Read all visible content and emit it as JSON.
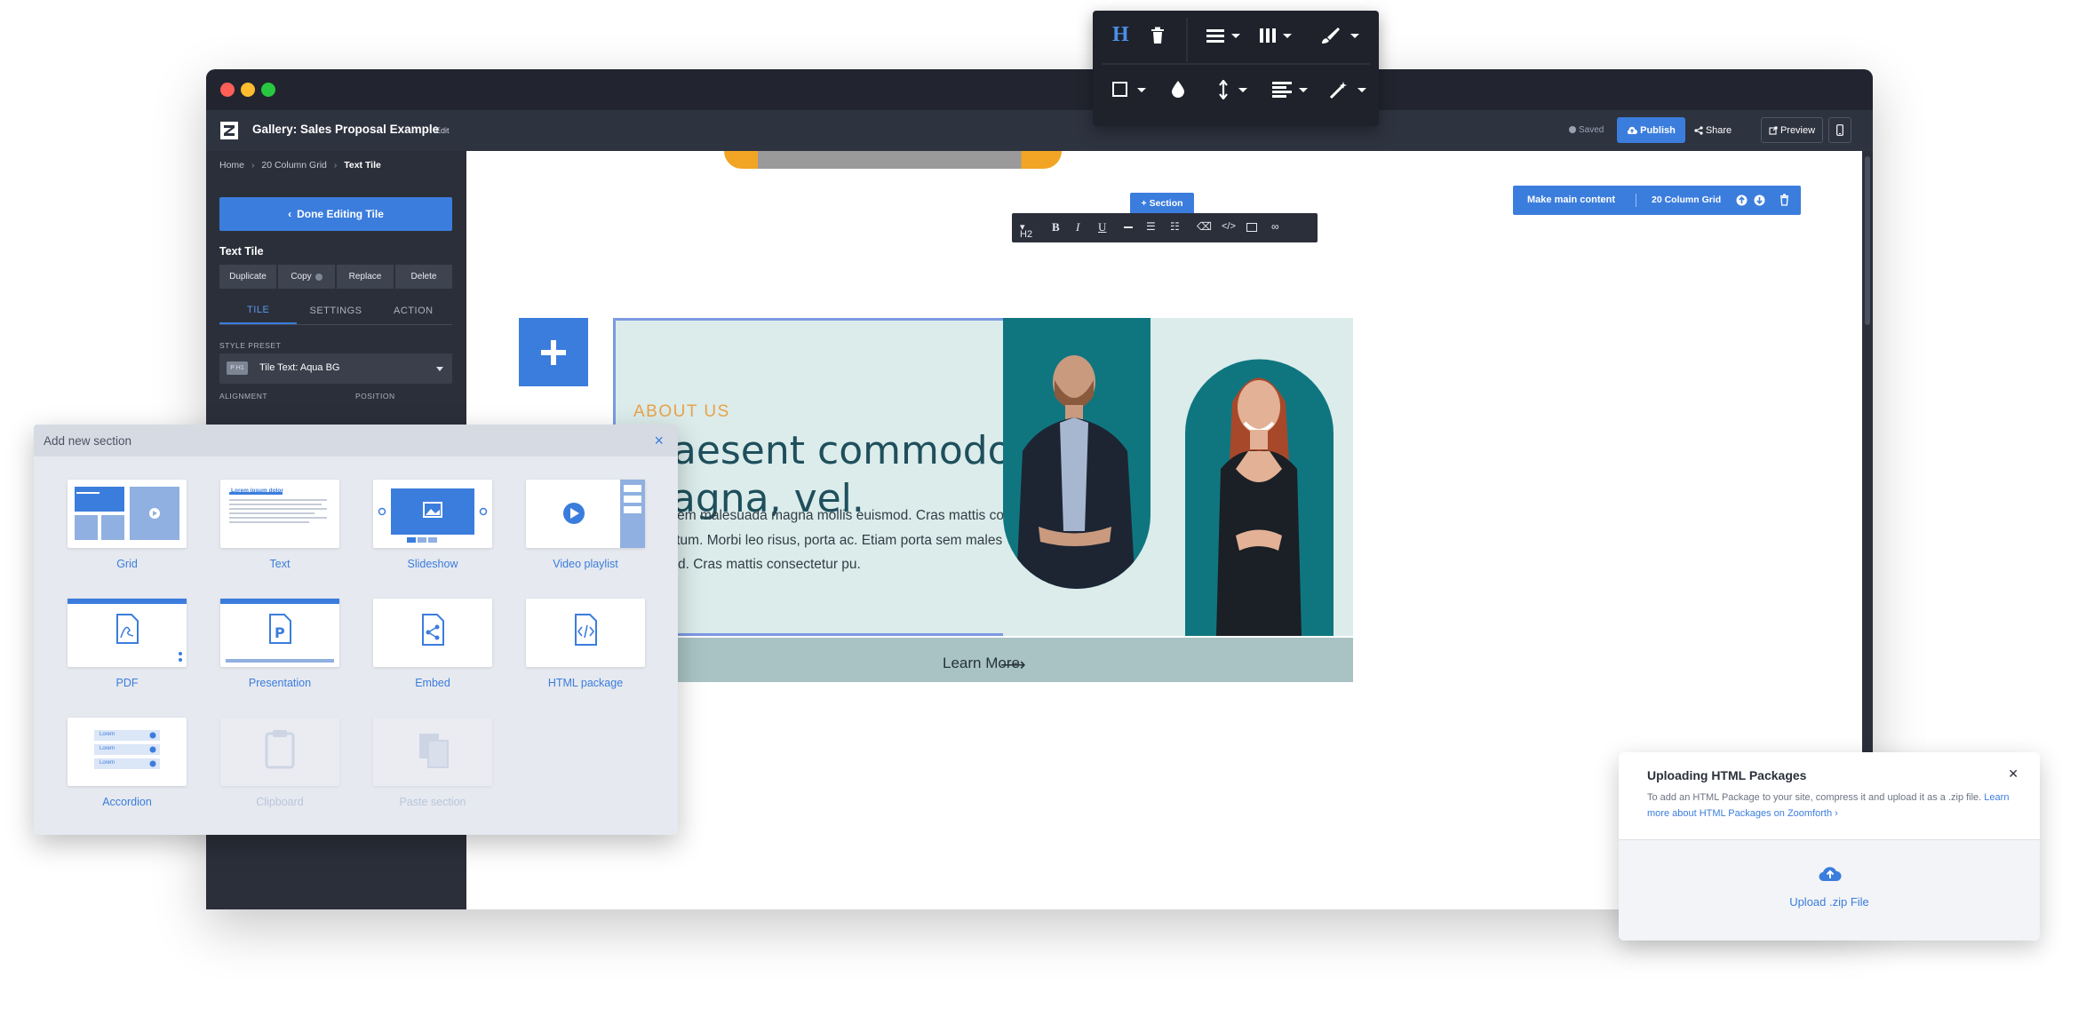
{
  "app": {
    "title": "Gallery: Sales Proposal Example",
    "edit_label": "Edit",
    "saved_label": "Saved",
    "publish_label": "Publish",
    "share_label": "Share",
    "preview_label": "Preview"
  },
  "sidebar": {
    "breadcrumb": [
      "Home",
      "20 Column Grid",
      "Text Tile"
    ],
    "done_label": "Done Editing Tile",
    "tile_title": "Text Tile",
    "actions": [
      "Duplicate",
      "Copy",
      "Replace",
      "Delete"
    ],
    "tabs": [
      "TILE",
      "SETTINGS",
      "ACTION"
    ],
    "active_tab": "TILE",
    "style_preset_label": "STYLE PRESET",
    "style_preset_value": "Tile Text: Aqua BG",
    "style_preset_swatch": "P H1",
    "alignment_label": "ALIGNMENT",
    "position_label": "POSITION"
  },
  "canvas": {
    "section_button": "Section",
    "make_main": "Make main content",
    "grid_label": "20 Column Grid",
    "format_toolbar": {
      "heading": "H2"
    },
    "about": "ABOUT US",
    "headline": "Praesent commodo cursus magna, vel.",
    "paragraph": "Porta sem malesuada magna mollis euismod. Cras mattis consectetur purus sit amet fermentum. Morbi leo risus, porta ac. Etiam porta sem malesuada magna mollis euismod. Cras mattis consectetur pu.",
    "learn_more": "Learn More"
  },
  "add_section": {
    "title": "Add new section",
    "items": [
      {
        "label": "Grid",
        "enabled": true
      },
      {
        "label": "Text",
        "enabled": true
      },
      {
        "label": "Slideshow",
        "enabled": true
      },
      {
        "label": "Video playlist",
        "enabled": true
      },
      {
        "label": "PDF",
        "enabled": true
      },
      {
        "label": "Presentation",
        "enabled": true
      },
      {
        "label": "Embed",
        "enabled": true
      },
      {
        "label": "HTML package",
        "enabled": true
      },
      {
        "label": "Accordion",
        "enabled": true
      },
      {
        "label": "Clipboard",
        "enabled": false
      },
      {
        "label": "Paste section",
        "enabled": false
      }
    ],
    "text_card_heading": "Lorem ipsum dolor",
    "accordion_item": "Lorem"
  },
  "upload": {
    "title": "Uploading HTML Packages",
    "description": "To add an HTML Package to your site, compress it and upload it as a .zip file.",
    "link": "Learn more about HTML Packages on Zoomforth ›",
    "button": "Upload .zip File"
  },
  "colors": {
    "accent": "#3b7ddd",
    "sidebar_bg": "#2b2f3a",
    "tile_bg": "#dbeceb",
    "about_color": "#e8a24a",
    "headline_color": "#1f4f5c",
    "learn_bar": "#a9c3c4",
    "photo_teal": "#0f7680"
  }
}
